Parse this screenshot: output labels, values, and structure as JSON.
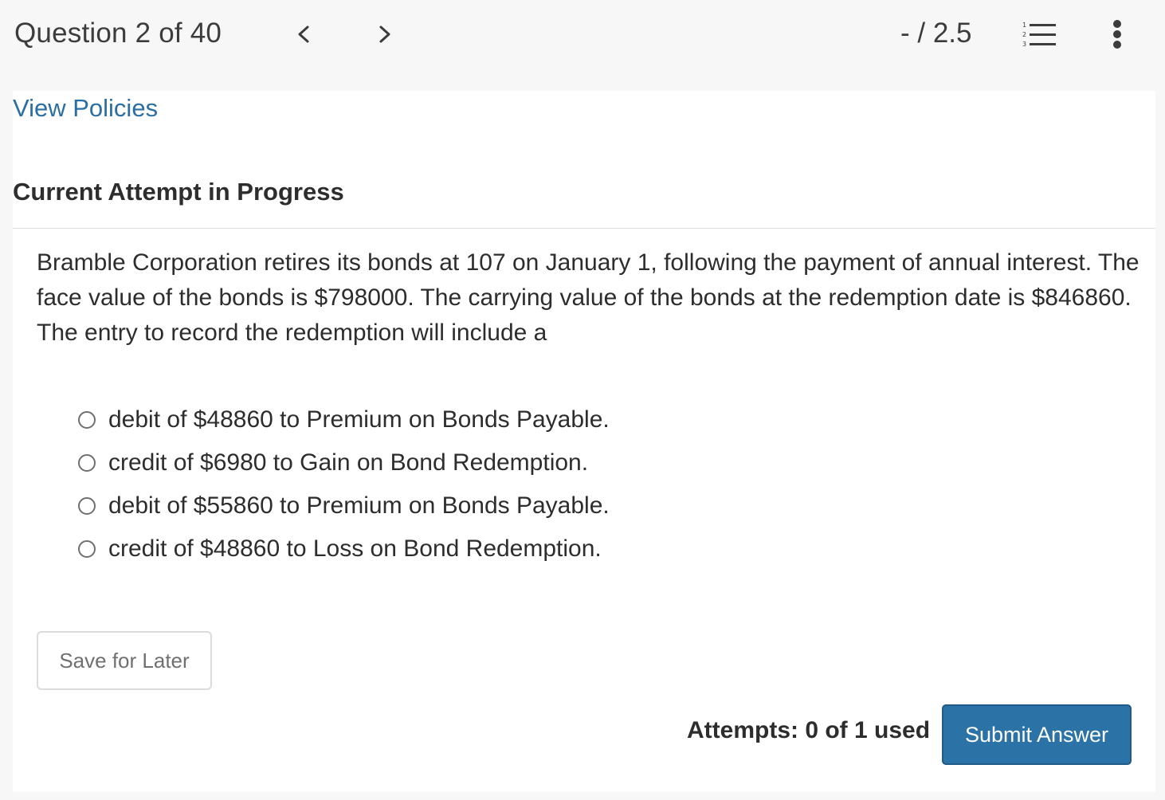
{
  "header": {
    "question_counter": "Question 2 of 40",
    "score": "- / 2.5",
    "icons": {
      "prev": "chevron-left-icon",
      "next": "chevron-right-icon",
      "list": "numbered-list-icon",
      "more": "more-vertical-icon"
    }
  },
  "panel": {
    "policies_link": "View Policies",
    "attempt_heading": "Current Attempt in Progress",
    "question": "Bramble Corporation retires its bonds at 107 on January 1, following the payment of annual interest. The face value of the bonds is $798000. The carrying value of the bonds at the redemption date is $846860. The entry to record the redemption will include a",
    "choices": [
      {
        "label": "debit of $48860 to Premium on Bonds Payable.",
        "selected": false
      },
      {
        "label": "credit of $6980 to Gain on Bond Redemption.",
        "selected": false
      },
      {
        "label": "debit of $55860 to Premium on Bonds Payable.",
        "selected": false
      },
      {
        "label": "credit of $48860 to Loss on Bond Redemption.",
        "selected": false
      }
    ],
    "save_button": "Save for Later",
    "attempts": "Attempts: 0 of 1 used",
    "submit_button": "Submit Answer"
  },
  "colors": {
    "link": "#2a6fa3",
    "primary_button": "#2b72a7",
    "page_background": "#f7f7f7"
  }
}
